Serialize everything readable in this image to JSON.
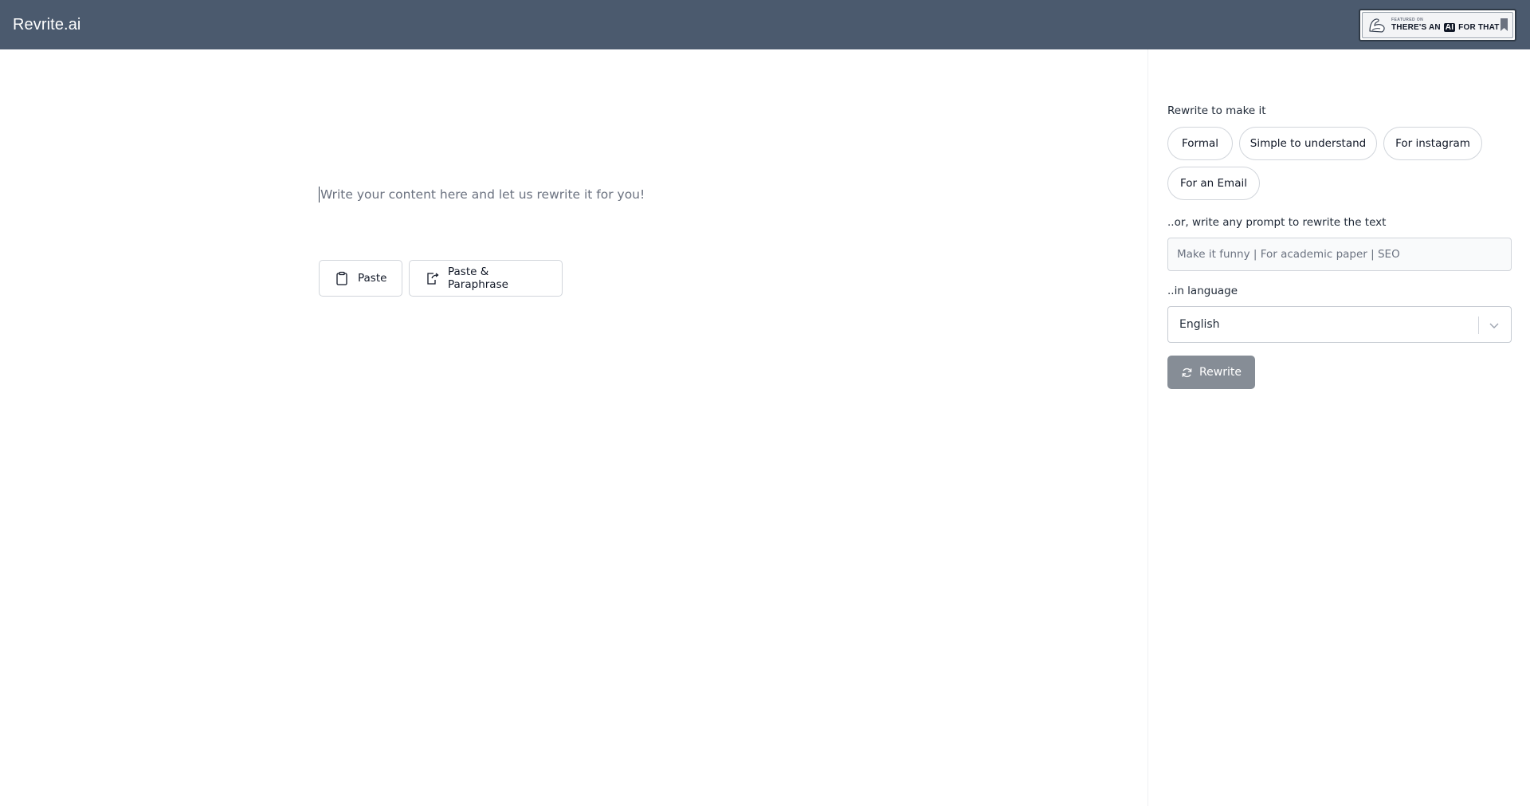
{
  "header": {
    "brand": "Revrite.ai",
    "badge": {
      "top_text": "FEATURED ON",
      "text_before": "THERE'S AN",
      "text_ai": "AI",
      "text_after": "FOR THAT"
    }
  },
  "editor": {
    "placeholder": "Write your content here and let us rewrite it for you!",
    "paste_label": "Paste",
    "paste_paraphrase_label": "Paste & Paraphrase"
  },
  "sidebar": {
    "rewrite_label": "Rewrite to make it",
    "chips": [
      "Formal",
      "Simple to understand",
      "For instagram",
      "For an Email"
    ],
    "prompt_label": "..or, write any prompt to rewrite the text",
    "prompt_placeholder": "Make it funny | For academic paper | SEO",
    "prompt_value": "",
    "language_label": "..in language",
    "language_value": "English",
    "rewrite_button": "Rewrite"
  },
  "colors": {
    "header_bg": "#4b5a6e",
    "rewrite_button_bg": "#868d96"
  }
}
